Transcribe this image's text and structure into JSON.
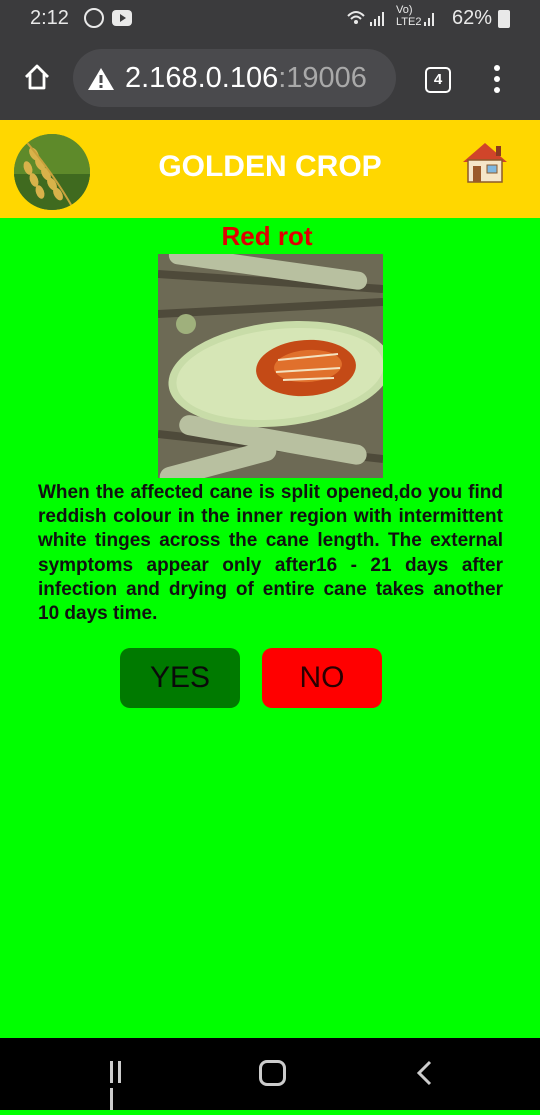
{
  "status_bar": {
    "time": "2:12",
    "network": "Vo) LTE2",
    "battery": "62%"
  },
  "browser": {
    "url_host": "2.168.0.106",
    "url_port": ":19006",
    "tab_count": "4"
  },
  "header": {
    "title": "GOLDEN CROP"
  },
  "disease": {
    "name": "Red rot",
    "question": "When the affected cane is split opened,do you find reddish colour in the inner region with intermittent white tinges across the cane length. The external symptoms appear only after16 - 21 days after infection and drying of entire cane takes another 10 days time."
  },
  "buttons": {
    "yes": "YES",
    "no": "NO"
  },
  "colors": {
    "background": "#00ff00",
    "header": "#ffd700",
    "title_red": "#e00000",
    "yes_green": "#007a00",
    "no_red": "#ff0000"
  },
  "icons": [
    "home-icon",
    "warning-icon",
    "tabs-icon",
    "menu-icon",
    "house-icon",
    "recents-icon",
    "nav-home-icon",
    "back-icon"
  ]
}
